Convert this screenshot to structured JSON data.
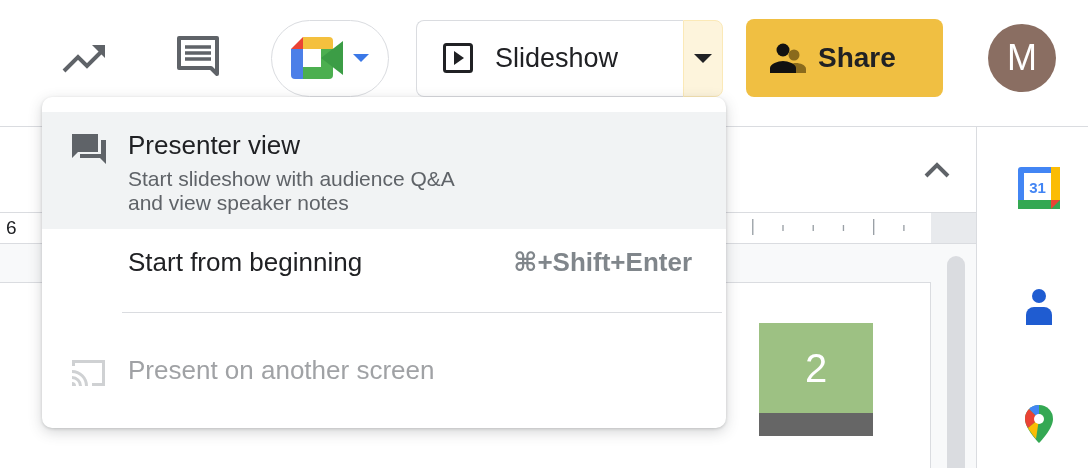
{
  "toolbar": {
    "meet_button": {
      "has_caret": true
    },
    "slideshow": {
      "label": "Slideshow",
      "menu_open": true
    },
    "share": {
      "label": "Share"
    },
    "avatar": {
      "initial": "M"
    }
  },
  "editor": {
    "ruler_label": "6",
    "slide_badge": "2"
  },
  "side_panel": {
    "calendar_day": "31"
  },
  "menu": {
    "items": [
      {
        "kind": "presenter",
        "label": "Presenter view",
        "description": "Start slideshow with audience Q&A\nand view speaker notes",
        "selected": true,
        "disabled": false
      },
      {
        "kind": "option",
        "label": "Start from beginning",
        "shortcut": "⌘+Shift+Enter",
        "selected": false,
        "disabled": false
      },
      {
        "kind": "separator"
      },
      {
        "kind": "cast",
        "label": "Present on another screen",
        "selected": false,
        "disabled": true
      }
    ]
  }
}
